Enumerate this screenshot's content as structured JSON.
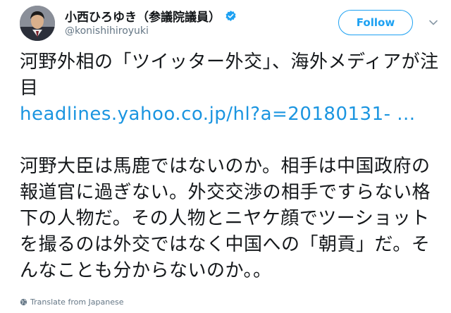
{
  "author": {
    "display_name": "小西ひろゆき（参議院議員）",
    "handle": "@konishihiroyuki",
    "verified_icon": "verified-badge-icon"
  },
  "actions": {
    "follow_label": "Follow",
    "menu_icon": "chevron-down-icon"
  },
  "tweet": {
    "paragraph1": "河野外相の「ツイッター外交」、海外メディアが注目",
    "link": "headlines.yahoo.co.jp/hl?a=20180131- ...",
    "paragraph2": "河野大臣は馬鹿ではないのか。相手は中国政府の報道官に過ぎない。外交交渉の相手ですらない格下の人物だ。その人物とニヤケ顔でツーショットを撮るのは外交ではなく中国への「朝貢」だ。そんなことも分からないのか。。"
  },
  "footer": {
    "translate_label": "Translate from Japanese",
    "translate_icon": "globe-icon"
  },
  "colors": {
    "accent": "#1da1f2",
    "link": "#1b95e0",
    "muted": "#657786",
    "text": "#14171a"
  }
}
